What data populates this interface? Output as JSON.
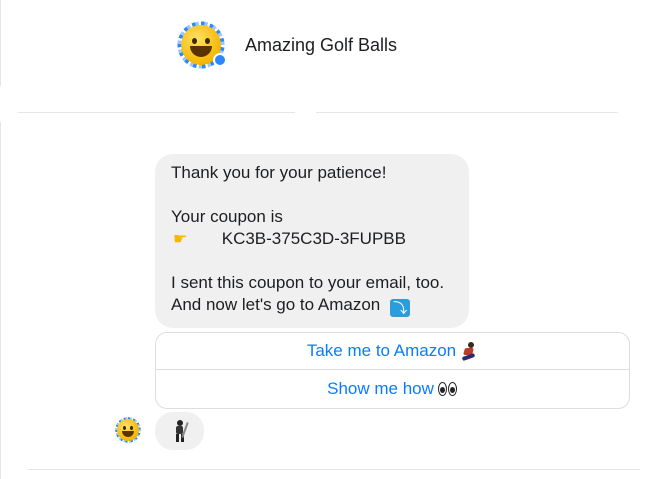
{
  "header": {
    "page_name": "Amazing Golf Balls",
    "avatar_icon": "smiling-emoji-avatar-icon"
  },
  "message": {
    "line1": "Thank you for your patience!",
    "line2": "Your coupon is",
    "coupon_code": "KC3B-375C3D-3FUPBB",
    "line3": "I sent this coupon to your email, too.",
    "line4": "And now let's go to Amazon",
    "point_icon": "pointing-right-icon",
    "arrow_icon": "right-arrow-curving-down-icon"
  },
  "quick_replies": [
    {
      "label": "Take me to Amazon",
      "icon": "running-person-icon"
    },
    {
      "label": "Show me how",
      "icon": "eyes-icon"
    }
  ],
  "reply": {
    "icon": "golfer-icon"
  },
  "colors": {
    "accent": "#0a7cff",
    "bubble": "#f0f0f0",
    "divider": "#e4e6eb"
  }
}
